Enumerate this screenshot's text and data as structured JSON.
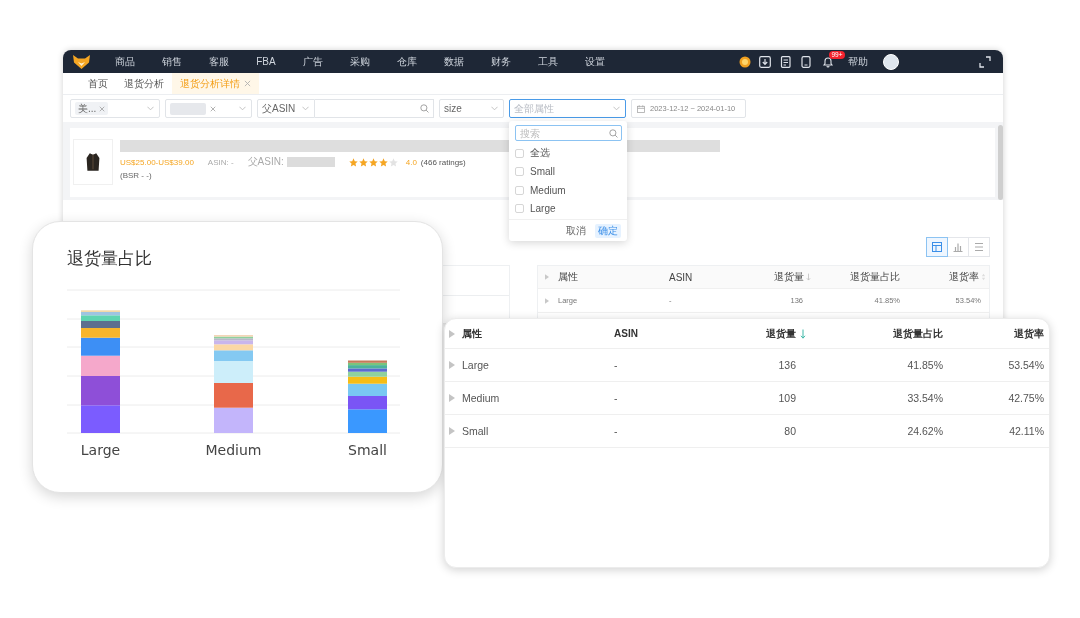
{
  "nav": {
    "items": [
      "商品",
      "销售",
      "客服",
      "FBA",
      "广告",
      "采购",
      "仓库",
      "数据",
      "财务",
      "工具",
      "设置"
    ],
    "notification_badge": "99+",
    "help": "帮助"
  },
  "tabs": [
    {
      "label": "首页",
      "selected": false,
      "closable": false
    },
    {
      "label": "退货分析",
      "selected": false,
      "closable": false
    },
    {
      "label": "退货分析详情",
      "selected": true,
      "closable": true
    }
  ],
  "filters": [
    {
      "kind": "tag-select",
      "tag": "美..."
    },
    {
      "kind": "masked-tag-select"
    },
    {
      "kind": "search-select",
      "option": "父ASIN"
    },
    {
      "kind": "select",
      "value": "size",
      "focused": false
    },
    {
      "kind": "select",
      "placeholder": "全部属性",
      "focused": true
    },
    {
      "kind": "date-range",
      "value": "2023-12-12 ~ 2024-01-10"
    }
  ],
  "product": {
    "price": "US$25.00-US$39.00",
    "asin": "ASIN: -",
    "parent_asin_label": "父ASIN:",
    "stars": 4,
    "rating": "4.0",
    "ratings_count": "(466 ratings)",
    "bsr": "(BSR - -)"
  },
  "attribute_dropdown": {
    "search_placeholder": "搜索",
    "options": [
      {
        "label": "全选",
        "checked": false
      },
      {
        "label": "Small",
        "checked": false
      },
      {
        "label": "Medium",
        "checked": false
      },
      {
        "label": "Large",
        "checked": false
      }
    ],
    "buttons": [
      {
        "label": "取消",
        "kind": "text"
      },
      {
        "label": "确定",
        "kind": "primary"
      }
    ]
  },
  "view_toggle": [
    {
      "kind": "table",
      "selected": true
    },
    {
      "kind": "chart",
      "selected": false
    },
    {
      "kind": "list",
      "selected": false
    }
  ],
  "background_table": {
    "columns": [
      {
        "label": "属性"
      },
      {
        "label": "ASIN"
      },
      {
        "label": "退货量",
        "sorted_desc": true
      },
      {
        "label": "退货量占比"
      },
      {
        "label": "退货率",
        "sortable": true
      }
    ],
    "rows": [
      {
        "cells": [
          "Large",
          "-",
          "136",
          "41.85%",
          "53.54%"
        ]
      }
    ]
  },
  "chart_card": {
    "title": "退货量占比",
    "bar_labels": [
      "Large",
      "Medium",
      "Small"
    ]
  },
  "table_card": {
    "columns": [
      {
        "label": "属性"
      },
      {
        "label": "ASIN"
      },
      {
        "label": "退货量",
        "sorted_desc": true
      },
      {
        "label": "退货量占比"
      },
      {
        "label": "退货率"
      }
    ],
    "rows": [
      {
        "cells": [
          "Large",
          "-",
          "136",
          "41.85%",
          "53.54%"
        ]
      },
      {
        "cells": [
          "Medium",
          "-",
          "109",
          "33.54%",
          "42.75%"
        ]
      },
      {
        "cells": [
          "Small",
          "-",
          "80",
          "24.62%",
          "42.11%"
        ]
      }
    ]
  }
}
